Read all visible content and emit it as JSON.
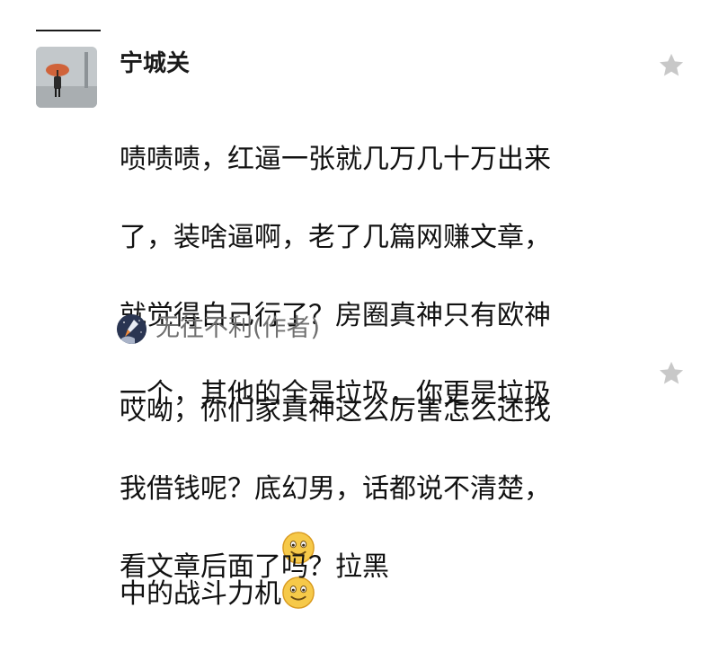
{
  "comment": {
    "author": "宁城关",
    "lines": [
      "啧啧啧，红逼一张就几万几十万出来",
      "了，装啥逼啊，老了几篇网赚文章，",
      "就觉得自己行了？房圈真神只有欧神",
      "一个，其他的全是垃圾，你更是垃圾",
      "中的战斗力机"
    ],
    "emojis": [
      "smile-emoji",
      "smile-emoji"
    ],
    "avatar_icon": "umbrella-person-photo",
    "favorite_icon": "star-icon"
  },
  "reply": {
    "author": "无往不利(作者)",
    "lines": [
      "哎呦，你们家真神这么厉害怎么还找",
      "我借钱呢？底幻男，话都说不清楚，",
      "看文章后面了吗？拉黑"
    ],
    "avatar_icon": "rocket-night-photo",
    "favorite_icon": "star-icon"
  },
  "colors": {
    "text": "#111111",
    "muted": "#6f6f6f",
    "star": "#c8c8c8"
  }
}
